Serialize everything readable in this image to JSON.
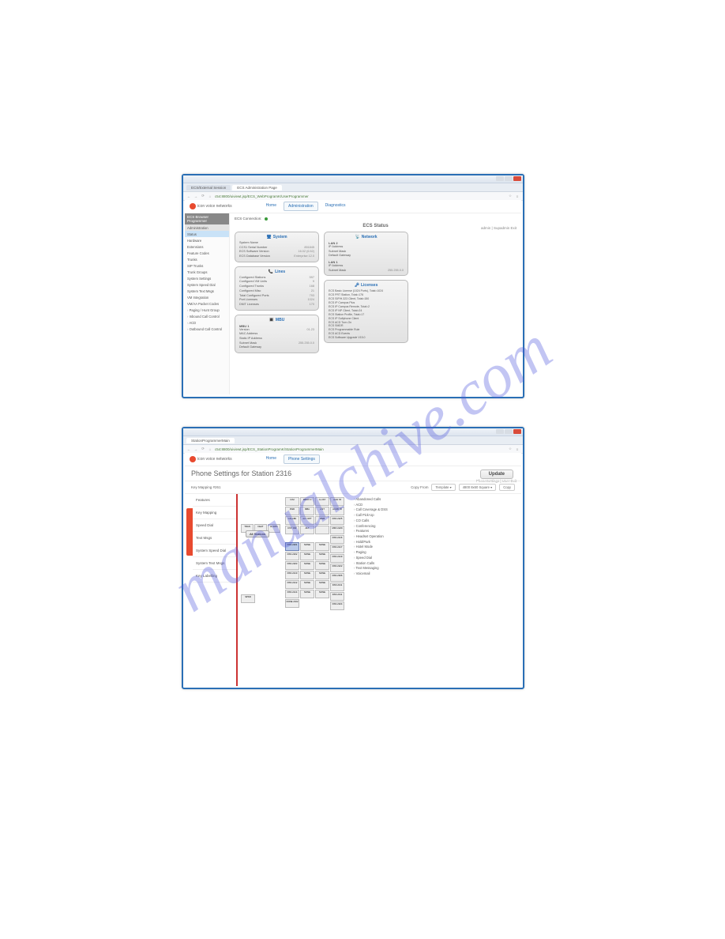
{
  "watermark": "manualchive.com",
  "win1": {
    "tabs": [
      "ECS/External Session",
      "ECS Administration Page"
    ],
    "url": "c54:8800/uiviewt.jsp/ECS_WebProgramK/UserProgrammer",
    "user": "admin | Supadmin   Exit",
    "brand": "icon voice networks",
    "topnav": {
      "home": "Home",
      "admin": "Administration",
      "diag": "Diagnostics"
    },
    "sidebar": {
      "header": "ECS Browser Programmer",
      "sec1": "Administration",
      "items1": [
        "Status",
        "Hardware",
        "Extensions",
        "Feature Codes",
        "Trunks",
        "SIP Trunks",
        "Trunk Groups",
        "System Settings",
        "System Speed Dial",
        "System Text Msgs",
        "VM Integration",
        "VM/AA Packet Codes"
      ],
      "items2": [
        "Paging / Hunt Group",
        "Inbound Call Control",
        "ACD",
        "Outbound Call Control"
      ]
    },
    "main": {
      "conn": "ECS Connection:",
      "title": "ECS Status",
      "system": {
        "h": "System",
        "rows": [
          [
            "System Name",
            ""
          ],
          [
            "CCS1 Serial Number",
            "851845"
          ],
          [
            "ECS Software Version",
            "16.02 (6.52)"
          ],
          [
            "ECS Database Version",
            "Enterprise 12.0"
          ]
        ]
      },
      "lines": {
        "h": "Lines",
        "rows": [
          [
            "Configured Stations",
            "597"
          ],
          [
            "Configured VM Units",
            "9"
          ],
          [
            "Configured Trunks",
            "168"
          ],
          [
            "Configured Misc",
            "21"
          ],
          [
            "Total Configured Ports",
            "793"
          ],
          [
            "Port Licenses",
            "1024"
          ],
          [
            "DNIT Licenses",
            "170"
          ]
        ]
      },
      "mbu": {
        "h": "MBU",
        "sub": "MBU 1",
        "rows": [
          [
            "Version",
            "01.23"
          ],
          [
            "MAC Address",
            ""
          ],
          [
            "Static IP Address",
            ""
          ],
          [
            "Subnet Mask",
            "255.255.0.0"
          ],
          [
            "Default Gateway",
            ""
          ]
        ]
      },
      "network": {
        "h": "Network",
        "lan2": "LAN 2",
        "lan2rows": [
          [
            "IP Address",
            ""
          ],
          [
            "Subnet Mask",
            ""
          ],
          [
            "Default Gateway",
            ""
          ]
        ],
        "lan1": "LAN 1",
        "lan1rows": [
          [
            "IP Address",
            ""
          ],
          [
            "Subnet Mask",
            "255.255.0.0"
          ]
        ]
      },
      "licenses": {
        "h": "Licenses",
        "items": [
          "ECS Basic License (1024 Ports), Total=1024",
          "ECS PRT Station, Total=176",
          "ECS SIP/H.323 Client, Total=150",
          "ECS IP Campus Plus",
          "ECS IP Campus Remote, Total=2",
          "ECS IP NP Client, Total=24",
          "ECS Station Profile, Total=17",
          "ECS IP Softphone Client",
          "ECS ACD Turn-On",
          "ECS SMDR",
          "ECS Programmable Rule",
          "ECS ACD Events",
          "ECS Software Upgrade V15.0"
        ]
      }
    }
  },
  "win2": {
    "tab": "StationProgrammerMain",
    "url": "c54:8800/uiviewt.jsp/ECS_StationProgramK/StationProgrammerMain",
    "user": "PhoneSettings | User   Exit",
    "brand": "icon voice networks",
    "topnav": {
      "home": "Home",
      "phone": "Phone Settings"
    },
    "title": "Phone Settings for Station 2316",
    "update": "Update",
    "kmbar": {
      "label": "Key Mapping #261",
      "copyfrom": "Copy From",
      "template": "Template",
      "model": "4800 8x60 Square",
      "copy": "Copy"
    },
    "leftnav": [
      "Features",
      "Key Mapping",
      "Speed Dial",
      "Text Msgs",
      "System Speed Dial",
      "System Text Msgs",
      "Key Labelling"
    ],
    "allstations": "All Stations",
    "leftkeys": [
      "TRAN",
      "FEAT",
      "HLD/Pk"
    ],
    "spkr": "SPKR",
    "keycols": [
      [
        "ICM",
        "FWD",
        "CALLBK",
        "DST DIR",
        "",
        "DSS 2201",
        "DSS 2202",
        "DSS 2203",
        "DSS 2210",
        "DSS 2212",
        "DSS 2214",
        "NONE 2162"
      ],
      [
        "MBOX 0",
        "MBA",
        "ALT OPT",
        "ALT",
        "",
        "NONE",
        "NONE",
        "NONE",
        "NONE",
        "NONE",
        "NONE",
        ""
      ],
      [
        "A LIST",
        "LIST",
        "WEB",
        "",
        "",
        "NONE",
        "NONE",
        "NONE",
        "NONE",
        "NONE",
        "NONE",
        ""
      ],
      [
        "ACD 78",
        "ACDB 78",
        "DSS 2225",
        "MFD 2229",
        "DSS 2216",
        "DSS 2217",
        "DSS 2219",
        "DSS 2222",
        "DSS 2306",
        "DSS 2211",
        "DSS 2311",
        "DSS 2324"
      ]
    ],
    "rightlist": [
      "Abandoned Calls",
      "ACD",
      "Call Coverage & DSS",
      "Call Pick-Up",
      "CO Calls",
      "Conferencing",
      "Features",
      "Headset Operation",
      "Hold/Park",
      "Hotel Mode",
      "Paging",
      "Speed Dial",
      "Station Calls",
      "Text Messaging",
      "Voicemail"
    ]
  }
}
